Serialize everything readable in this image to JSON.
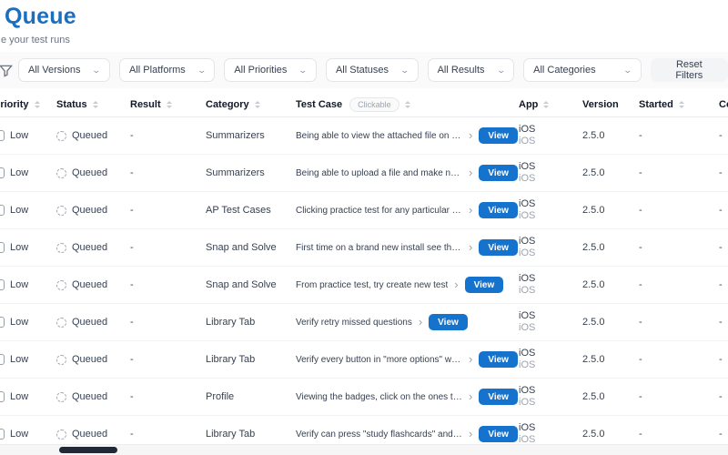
{
  "page": {
    "title": "Queue",
    "subtitle": "e your test runs"
  },
  "colors": {
    "title_blue": "#1b6fc0",
    "view_button_blue": "#1573cd"
  },
  "filters": {
    "items": [
      "All Versions",
      "All Platforms",
      "All Priorities",
      "All Statuses",
      "All Results",
      "All Categories"
    ],
    "reset_label": "Reset Filters"
  },
  "table": {
    "headers": {
      "priority": "Priority",
      "status": "Status",
      "result": "Result",
      "category": "Category",
      "test_case": "Test Case",
      "app": "App",
      "version": "Version",
      "started": "Started",
      "completed": "Completed"
    },
    "clickable_badge": "Clickable",
    "view_label": "View",
    "chevron": "›",
    "rows": [
      {
        "priority": "Low",
        "status": "Queued",
        "result": "-",
        "category": "Summarizers",
        "test_case": "Being able to view the attached file on a note",
        "app_primary": "iOS",
        "app_secondary": "iOS",
        "version": "2.5.0",
        "started": "-",
        "completed": "-"
      },
      {
        "priority": "Low",
        "status": "Queued",
        "result": "-",
        "category": "Summarizers",
        "test_case": "Being able to upload a file and make notes",
        "app_primary": "iOS",
        "app_secondary": "iOS",
        "version": "2.5.0",
        "started": "-",
        "completed": "-"
      },
      {
        "priority": "Low",
        "status": "Queued",
        "result": "-",
        "category": "AP Test Cases",
        "test_case": "Clicking practice test for any particular exa...",
        "app_primary": "iOS",
        "app_secondary": "iOS",
        "version": "2.5.0",
        "started": "-",
        "completed": "-"
      },
      {
        "priority": "Low",
        "status": "Queued",
        "result": "-",
        "category": "Snap and Solve",
        "test_case": "First time on a brand new install see the sn...",
        "app_primary": "iOS",
        "app_secondary": "iOS",
        "version": "2.5.0",
        "started": "-",
        "completed": "-"
      },
      {
        "priority": "Low",
        "status": "Queued",
        "result": "-",
        "category": "Snap and Solve",
        "test_case": "From practice test, try create new test",
        "app_primary": "iOS",
        "app_secondary": "iOS",
        "version": "2.5.0",
        "started": "-",
        "completed": "-"
      },
      {
        "priority": "Low",
        "status": "Queued",
        "result": "-",
        "category": "Library Tab",
        "test_case": "Verify retry missed questions",
        "app_primary": "iOS",
        "app_secondary": "iOS",
        "version": "2.5.0",
        "started": "-",
        "completed": "-"
      },
      {
        "priority": "Low",
        "status": "Queued",
        "result": "-",
        "category": "Library Tab",
        "test_case": "Verify every button in \"more options\" work...",
        "app_primary": "iOS",
        "app_secondary": "iOS",
        "version": "2.5.0",
        "started": "-",
        "completed": "-"
      },
      {
        "priority": "Low",
        "status": "Queued",
        "result": "-",
        "category": "Profile",
        "test_case": "Viewing the badges, click on the ones that ...",
        "app_primary": "iOS",
        "app_secondary": "iOS",
        "version": "2.5.0",
        "started": "-",
        "completed": "-"
      },
      {
        "priority": "Low",
        "status": "Queued",
        "result": "-",
        "category": "Library Tab",
        "test_case": "Verify can press \"study flashcards\" and try...",
        "app_primary": "iOS",
        "app_secondary": "iOS",
        "version": "2.5.0",
        "started": "-",
        "completed": "-"
      }
    ]
  }
}
